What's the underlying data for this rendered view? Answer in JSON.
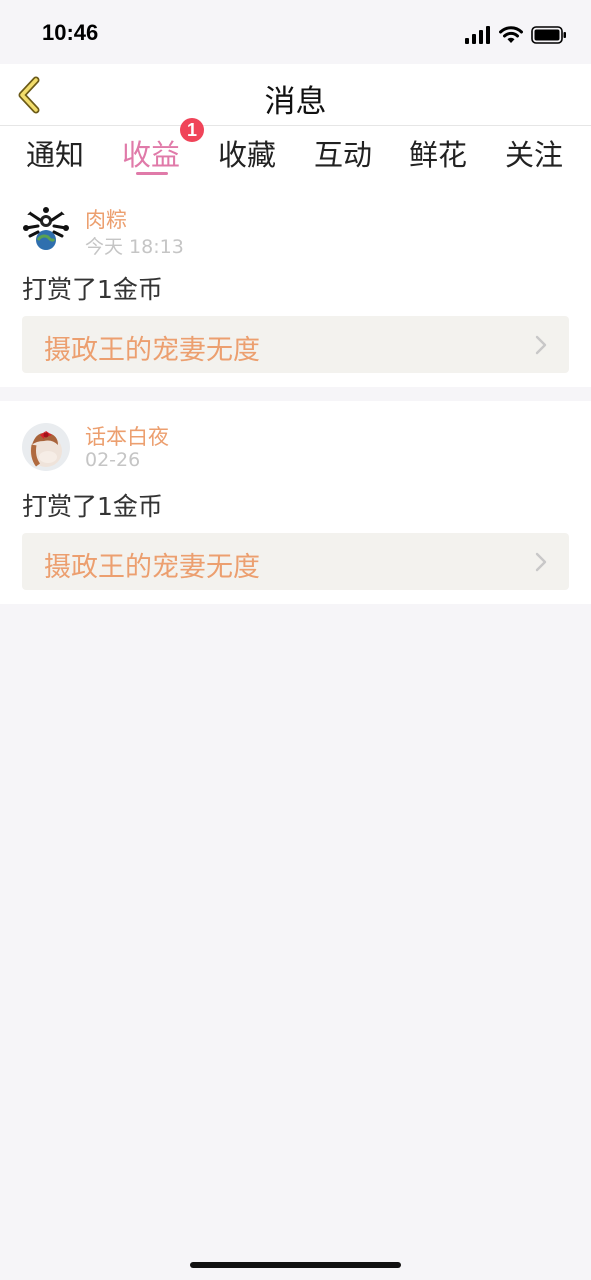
{
  "status_bar": {
    "time": "10:46",
    "icons": [
      "signal-icon",
      "wifi-icon",
      "battery-icon"
    ]
  },
  "nav": {
    "title": "消息",
    "back_icon": "chevron-left-icon"
  },
  "tabs": [
    {
      "label": "通知"
    },
    {
      "label": "收益",
      "badge": "1"
    },
    {
      "label": "收藏"
    },
    {
      "label": "互动"
    },
    {
      "label": "鲜花"
    },
    {
      "label": "关注"
    }
  ],
  "active_tab": "收益",
  "messages": [
    {
      "user": "肉粽",
      "time": "今天 18:13",
      "text": "打赏了1金币",
      "book": "摄政王的宠妻无度"
    },
    {
      "user": "话本白夜",
      "time": "02-26",
      "text": "打赏了1金币",
      "book": "摄政王的宠妻无度"
    }
  ],
  "colors": {
    "accent": "#e07aa9",
    "name": "#ec9f6f",
    "badge": "#f04459",
    "background": "#f6f5f8"
  }
}
